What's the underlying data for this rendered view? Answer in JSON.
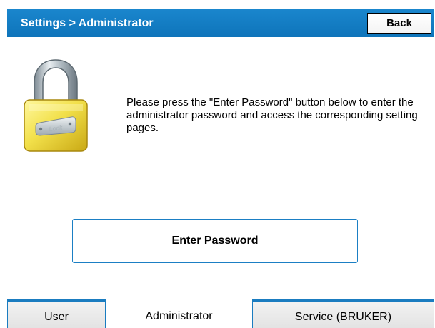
{
  "header": {
    "title": "Settings > Administrator",
    "back_label": "Back",
    "bar_color": "#0e74ba"
  },
  "lock": {
    "icon": "padlock-icon",
    "engraving": "Lock"
  },
  "message": "Please press the \"Enter Password\" button below to enter the administrator password and access the corresponding setting pages.",
  "enter_password_label": "Enter Password",
  "tabs": [
    {
      "label": "User",
      "active": false
    },
    {
      "label": "Administrator",
      "active": true
    },
    {
      "label": "Service (BRUKER)",
      "active": false
    }
  ],
  "colors": {
    "accent": "#1a7cc0",
    "tab_inactive": "#e8e8e8"
  }
}
